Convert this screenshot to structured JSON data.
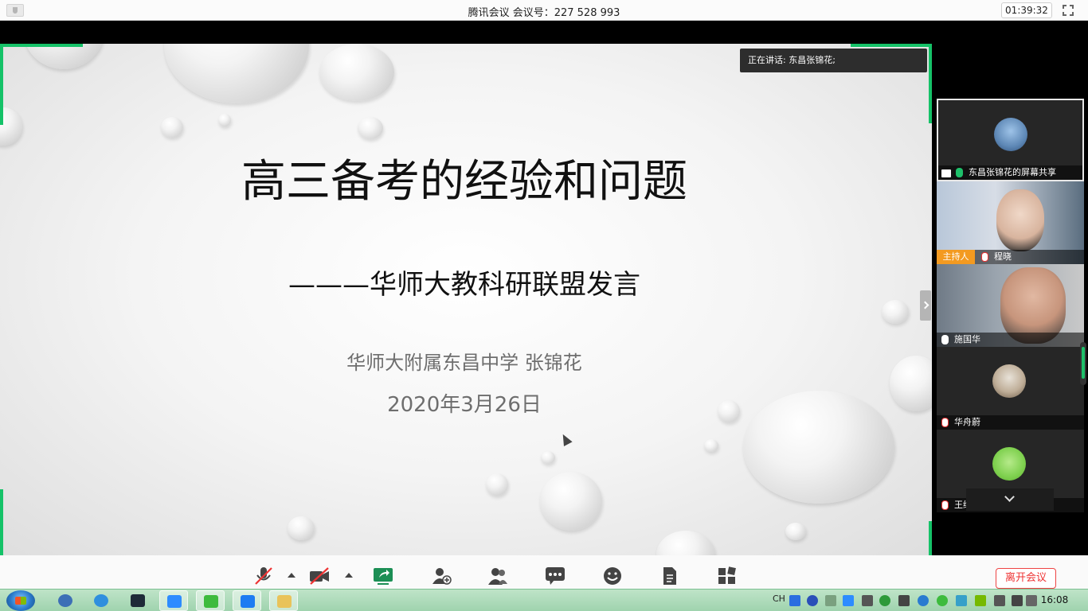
{
  "app": {
    "window_title": "腾讯会议 会议号：227 528 993",
    "elapsed_time": "01:39:32"
  },
  "slide": {
    "title": "高三备考的经验和问题",
    "subtitle": "———华师大教科研联盟发言",
    "author": "华师大附属东昌中学 张锦花",
    "date": "2020年3月26日"
  },
  "speaking_indicator": "正在讲话: 东昌张锦花;",
  "participants": [
    {
      "name": "东昌张锦花的屏幕共享",
      "mic": "on",
      "selected": true,
      "screen_share": true
    },
    {
      "name": "程晓",
      "mic": "muted",
      "host": true,
      "host_label": "主持人"
    },
    {
      "name": "施国华",
      "mic": "on"
    },
    {
      "name": "华舟蔚",
      "mic": "muted"
    },
    {
      "name": "王继勋",
      "mic": "muted"
    }
  ],
  "toolbar": {
    "buttons": [
      {
        "id": "mic",
        "icon": "mic-muted-icon"
      },
      {
        "id": "camera",
        "icon": "camera-off-icon"
      },
      {
        "id": "share-screen",
        "icon": "share-screen-icon"
      },
      {
        "id": "invite",
        "icon": "add-user-icon"
      },
      {
        "id": "members",
        "icon": "members-icon"
      },
      {
        "id": "chat",
        "icon": "chat-icon"
      },
      {
        "id": "reactions",
        "icon": "smile-icon"
      },
      {
        "id": "documents",
        "icon": "document-icon"
      },
      {
        "id": "apps",
        "icon": "apps-icon"
      }
    ],
    "leave_label": "离开会议"
  },
  "taskbar": {
    "language": "CH",
    "clock": "16:08",
    "apps": [
      {
        "icon": "network-icon"
      },
      {
        "icon": "ie-icon"
      },
      {
        "icon": "terminal-icon"
      },
      {
        "icon": "zoom-icon",
        "active": true
      },
      {
        "icon": "wechat-icon",
        "active": true
      },
      {
        "icon": "tencent-meeting-icon",
        "active": true
      },
      {
        "icon": "folder-icon",
        "active": true
      }
    ]
  },
  "colors": {
    "share_border": "#15c268",
    "host_badge": "#f39a20",
    "leave_red": "#e33333"
  }
}
